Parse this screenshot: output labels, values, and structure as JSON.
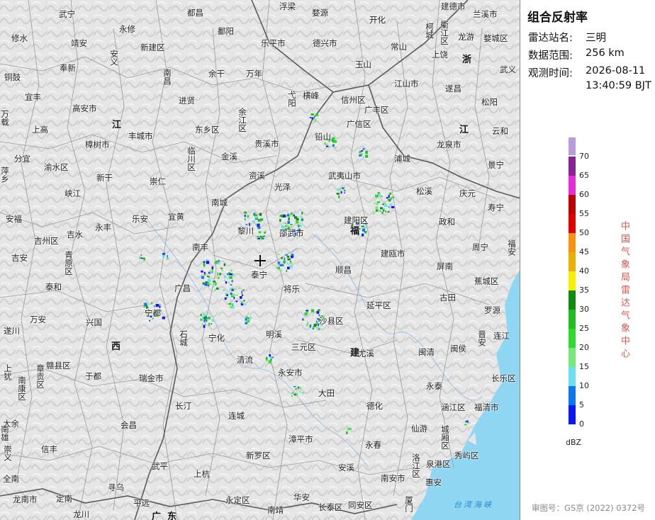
{
  "panel": {
    "title": "组合反射率",
    "station_label": "雷达站名:",
    "station_value": "三明",
    "range_label": "数据范围:",
    "range_value": "256 km",
    "time_label": "观测时间:",
    "time_date": "2026-08-11",
    "time_clock": "13:40:59 BJT",
    "unit": "dBZ",
    "agency": "中国气象局雷达气象中心",
    "review": "审图号：GS京 (2022) 0372号"
  },
  "legend": [
    {
      "value": "70",
      "color": "#b89cdc"
    },
    {
      "value": "65",
      "color": "#8a2396"
    },
    {
      "value": "60",
      "color": "#e62cd8"
    },
    {
      "value": "55",
      "color": "#c00000"
    },
    {
      "value": "50",
      "color": "#e00000"
    },
    {
      "value": "45",
      "color": "#f89010"
    },
    {
      "value": "40",
      "color": "#e8b000"
    },
    {
      "value": "35",
      "color": "#f8f000"
    },
    {
      "value": "30",
      "color": "#108a10"
    },
    {
      "value": "25",
      "color": "#20bc20"
    },
    {
      "value": "20",
      "color": "#30d830"
    },
    {
      "value": "15",
      "color": "#78e87c"
    },
    {
      "value": "10",
      "color": "#6ce0f0"
    },
    {
      "value": "5",
      "color": "#0c78f0"
    },
    {
      "value": "0",
      "color": "#0c18f0"
    }
  ],
  "map": {
    "places": [
      {
        "t": "武宁"
      },
      {
        "t": "都昌"
      },
      {
        "t": "浮梁"
      },
      {
        "t": "婺源"
      },
      {
        "t": "开化"
      },
      {
        "t": "常山"
      },
      {
        "t": "建德市"
      },
      {
        "t": "兰溪市"
      },
      {
        "t": "修水"
      },
      {
        "t": "永修"
      },
      {
        "t": "鄱阳"
      },
      {
        "t": "乐平市"
      },
      {
        "t": "德兴市"
      },
      {
        "t": "龙游"
      },
      {
        "t": "婺城区"
      },
      {
        "t": "靖安"
      },
      {
        "t": "新建区"
      },
      {
        "t": "余干"
      },
      {
        "t": "万年"
      },
      {
        "t": "玉山"
      },
      {
        "t": "武义"
      },
      {
        "t": "奉新"
      },
      {
        "t": "铜鼓"
      },
      {
        "t": "宜丰"
      },
      {
        "t": "进贤"
      },
      {
        "t": "横峰"
      },
      {
        "t": "信州区"
      },
      {
        "t": "江山市"
      },
      {
        "t": "遂昌"
      },
      {
        "t": "松阳"
      },
      {
        "t": "高安市"
      },
      {
        "t": "广丰区"
      },
      {
        "t": "上饶"
      },
      {
        "t": "上高"
      },
      {
        "t": "丰城市"
      },
      {
        "t": "东乡区"
      },
      {
        "t": "贵溪市"
      },
      {
        "t": "广信区"
      },
      {
        "t": "云和"
      },
      {
        "t": "樟树市"
      },
      {
        "t": "铅山"
      },
      {
        "t": "龙泉市"
      },
      {
        "t": "分宜"
      },
      {
        "t": "渝水区"
      },
      {
        "t": "金溪"
      },
      {
        "t": "浦城"
      },
      {
        "t": "景宁"
      },
      {
        "t": "新干"
      },
      {
        "t": "崇仁"
      },
      {
        "t": "资溪"
      },
      {
        "t": "武夷山市"
      },
      {
        "t": "峡江"
      },
      {
        "t": "光泽"
      },
      {
        "t": "松溪"
      },
      {
        "t": "庆元"
      },
      {
        "t": "南城"
      },
      {
        "t": "寿宁"
      },
      {
        "t": "安福"
      },
      {
        "t": "乐安"
      },
      {
        "t": "宜黄"
      },
      {
        "t": "政和"
      },
      {
        "t": "永丰"
      },
      {
        "t": "黎川"
      },
      {
        "t": "邵武市"
      },
      {
        "t": "建阳区"
      },
      {
        "t": "吉州区"
      },
      {
        "t": "吉水"
      },
      {
        "t": "南丰"
      },
      {
        "t": "周宁"
      },
      {
        "t": "吉安"
      },
      {
        "t": "建瓯市"
      },
      {
        "t": "屏南"
      },
      {
        "t": "泰和"
      },
      {
        "t": "广昌"
      },
      {
        "t": "泰宁"
      },
      {
        "t": "将乐"
      },
      {
        "t": "顺昌"
      },
      {
        "t": "蕉城区"
      },
      {
        "t": "万安"
      },
      {
        "t": "兴国"
      },
      {
        "t": "宁都"
      },
      {
        "t": "古田"
      },
      {
        "t": "延平区"
      },
      {
        "t": "罗源"
      },
      {
        "t": "遂川"
      },
      {
        "t": "沙县区"
      },
      {
        "t": "连江"
      },
      {
        "t": "宁化"
      },
      {
        "t": "明溪"
      },
      {
        "t": "三元区"
      },
      {
        "t": "尤溪"
      },
      {
        "t": "闽清"
      },
      {
        "t": "闽侯"
      },
      {
        "t": "赣县区"
      },
      {
        "t": "于都"
      },
      {
        "t": "瑞金市"
      },
      {
        "t": "清流"
      },
      {
        "t": "永安市"
      },
      {
        "t": "长乐区"
      },
      {
        "t": "永泰"
      },
      {
        "t": "大田"
      },
      {
        "t": "大余"
      },
      {
        "t": "长汀"
      },
      {
        "t": "德化"
      },
      {
        "t": "涵江区"
      },
      {
        "t": "福清市"
      },
      {
        "t": "会昌"
      },
      {
        "t": "连城"
      },
      {
        "t": "仙游"
      },
      {
        "t": "信丰"
      },
      {
        "t": "漳平市"
      },
      {
        "t": "永春"
      },
      {
        "t": "全南"
      },
      {
        "t": "武平"
      },
      {
        "t": "上杭"
      },
      {
        "t": "新罗区"
      },
      {
        "t": "泉港区"
      },
      {
        "t": "秀屿区"
      },
      {
        "t": "安溪"
      },
      {
        "t": "南安市"
      },
      {
        "t": "惠安"
      },
      {
        "t": "寻乌"
      },
      {
        "t": "龙南市"
      },
      {
        "t": "定南"
      },
      {
        "t": "平远"
      },
      {
        "t": "永定区"
      },
      {
        "t": "南靖"
      },
      {
        "t": "华安"
      },
      {
        "t": "长泰区"
      },
      {
        "t": "同安区"
      },
      {
        "t": "龙川"
      }
    ],
    "vplaces": [
      {
        "t": "南昌"
      },
      {
        "t": "安义"
      },
      {
        "t": "弋阳"
      },
      {
        "t": "余江区"
      },
      {
        "t": "临川区"
      },
      {
        "t": "柯城"
      },
      {
        "t": "衢江区"
      },
      {
        "t": "南康区"
      },
      {
        "t": "上犹"
      },
      {
        "t": "崇义"
      },
      {
        "t": "章贡区"
      },
      {
        "t": "石城"
      },
      {
        "t": "青原区"
      },
      {
        "t": "福安"
      },
      {
        "t": "晋安"
      },
      {
        "t": "城厢区"
      },
      {
        "t": "洛江区"
      },
      {
        "t": "万载"
      },
      {
        "t": "萍乡"
      },
      {
        "t": "南雄"
      },
      {
        "t": "厦门"
      }
    ],
    "provinces": [
      {
        "t": "江"
      },
      {
        "t": "西"
      },
      {
        "t": "福"
      },
      {
        "t": "建"
      },
      {
        "t": "浙"
      },
      {
        "t": "江"
      },
      {
        "t": "广"
      },
      {
        "t": "东"
      }
    ],
    "sea": "台湾海峡"
  }
}
